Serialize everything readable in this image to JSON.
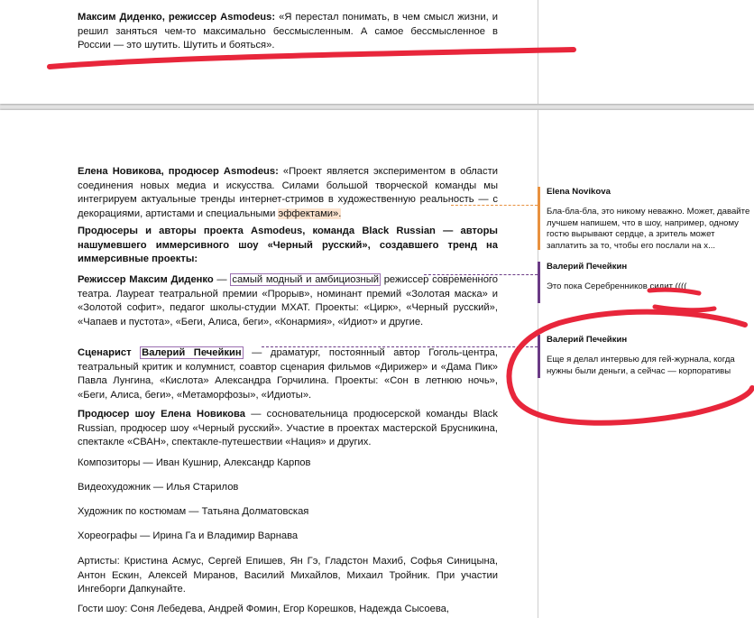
{
  "page1": {
    "para_bold": "Максим Диденко, режиссер Asmodeus:",
    "para_text": " «Я перестал понимать, в чем смысл жизни, и решил заняться чем-то максимально бессмысленным. А самое бессмысленное в России — это шутить. Шутить и бояться»."
  },
  "page2": {
    "p1_bold": "Елена Новикова, продюсер Asmodeus:",
    "p1_text": " «Проект является экспериментом в области соединения новых медиа и искусства. Силами большой творческой команды мы интегрируем актуальные тренды интернет-стримов в художественную реальность — с декорациями, артистами и специальными ",
    "p1_hl": "эффектами».",
    "p2_bold": "Продюсеры и авторы проекта Asmodeus, команда Black Russian — авторы нашумевшего иммерсивного шоу «Черный русский», создавшего тренд на иммерсивные проекты:",
    "p3_bold": "Режиссер Максим Диденко",
    "p3_dash": " — ",
    "p3_hl": "самый модный и амбициозный",
    "p3_text": " режиссер современного театра. Лауреат театральной премии «Прорыв», номинант премий «Золотая маска» и «Золотой софит», педагог школы-студии МХАТ. Проекты: «Цирк», «Черный русский», «Чапаев и пустота», «Беги, Алиса, беги», «Конармия», «Идиот» и другие.",
    "p4_bold1": "Сценарист ",
    "p4_hl": "Валерий Печейкин",
    "p4_text": " — драматург, постоянный автор Гоголь-центра, театральный критик и колумнист, соавтор сценария фильмов «Дирижер» и «Дама Пик» Павла Лунгина, «Кислота» Александра Горчилина. Проекты: «Сон в летнюю ночь», «Беги, Алиса, беги», «Метаморфозы», «Идиоты».",
    "p5_bold": "Продюсер шоу Елена Новикова",
    "p5_text": " — сосновательница продюсерской команды Black Russian, продюсер шоу «Черный русский». Участие в проектах мастерской Брусникина, спектакле «СВАН», спектакле-путешествии «Нация» и других.",
    "p6": "Композиторы — Иван Кушнир, Александр Карпов",
    "p7": "Видеохудожник — Илья Старилов",
    "p8": "Художник по костюмам — Татьяна Долматовская",
    "p9": "Хореографы — Ирина Га и Владимир Варнава",
    "p10": "Артисты: Кристина Асмус, Сергей Епишев, Ян Гэ, Гладстон Махиб, Софья Синицына, Антон Ескин, Алексей Миранов, Василий Михайлов, Михаил Тройник. При участии Ингеборги Дапкунайте.",
    "p11": "Гости шоу: Соня Лебедева, Андрей Фомин, Егор Корешков, Надежда Сысоева,"
  },
  "comments": [
    {
      "author": "Elena Novikova",
      "text": "Бла-бла-бла, это никому неважно. Может, давайте лучшем напишем, что в шоу, например, одному гостю вырывают сердце, а зритель может заплатить за то, чтобы его послали на х..."
    },
    {
      "author": "Валерий Печейкин",
      "text": "Это пока Серебренников сидит (((("
    },
    {
      "author": "Валерий Печейкин",
      "text": "Еще я делал интервью для гей-журнала, когда нужны были деньги, а сейчас — корпоративы"
    }
  ],
  "colors": {
    "orange": "#e8913f",
    "purple": "#6b3b86",
    "scribble": "#e8263b"
  }
}
